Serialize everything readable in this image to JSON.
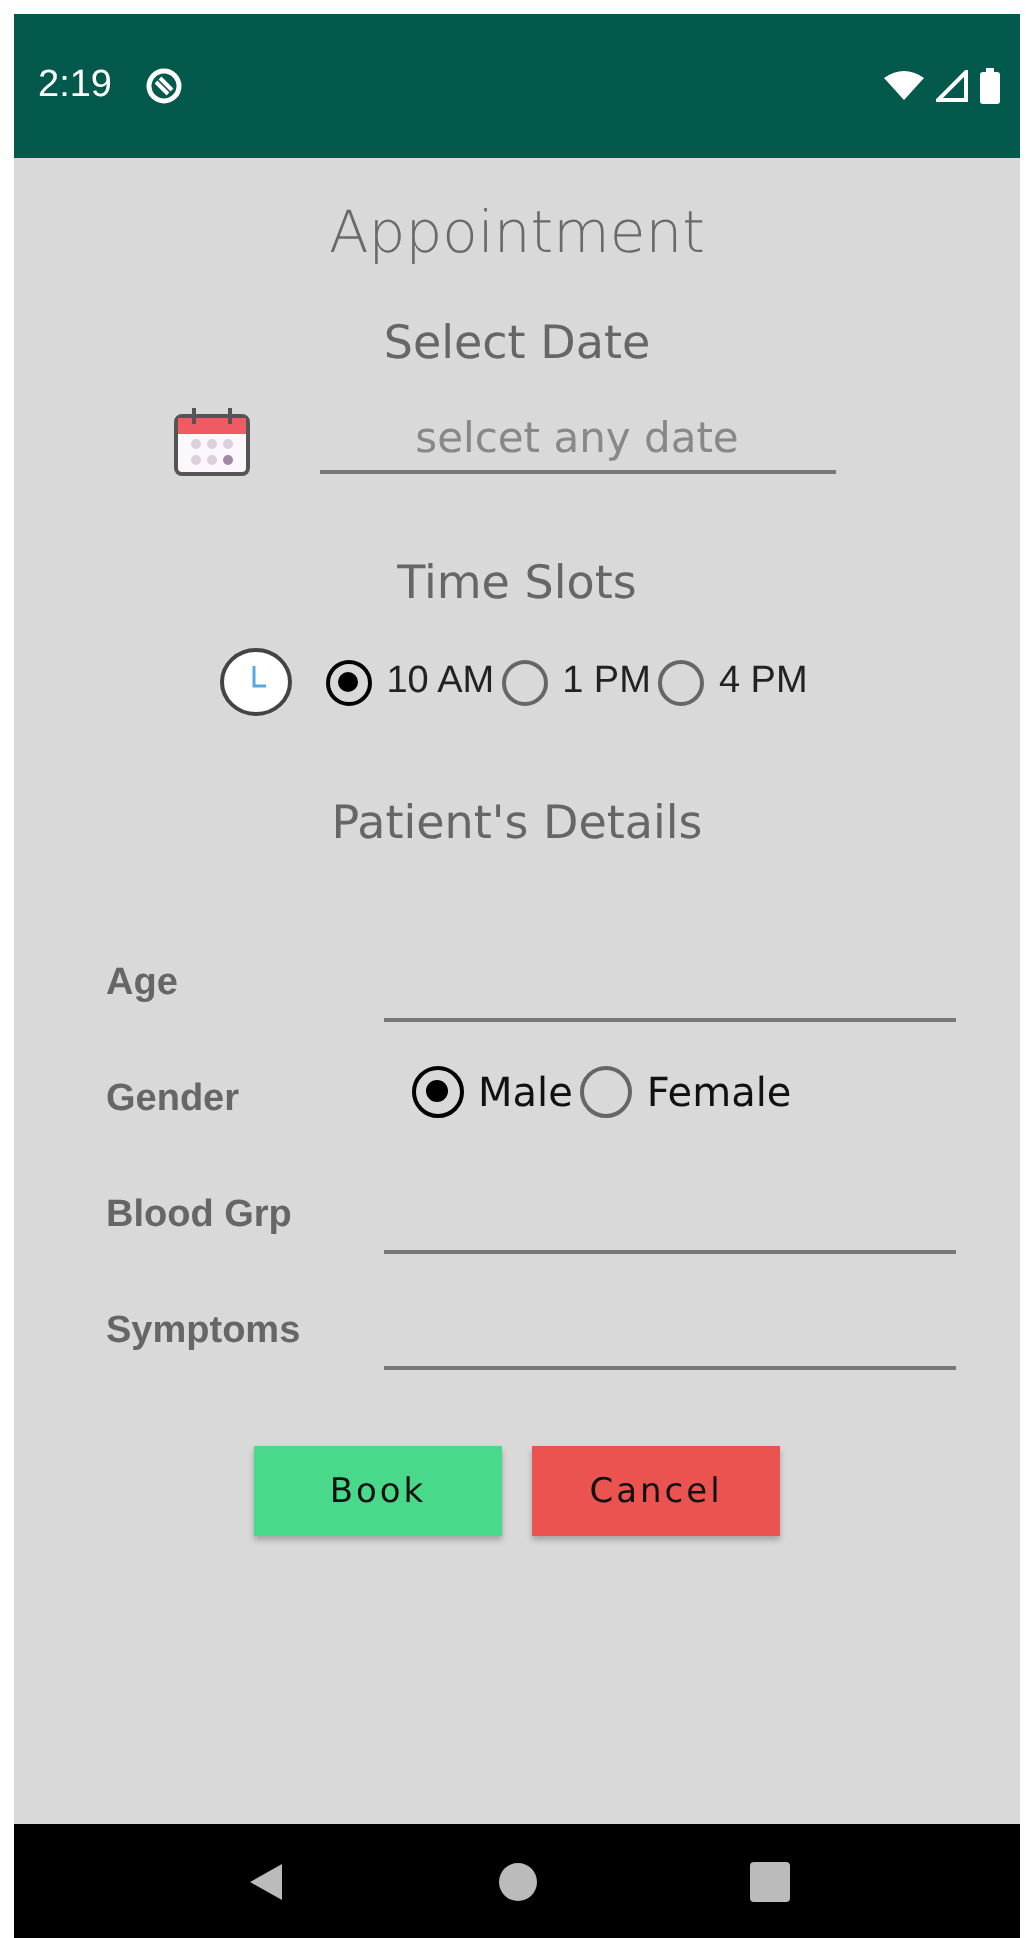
{
  "status_bar": {
    "time": "2:19"
  },
  "title": "Appointment",
  "date_section": {
    "heading": "Select Date",
    "placeholder": "selcet any date"
  },
  "time_section": {
    "heading": "Time Slots",
    "slots": [
      {
        "label": "10 AM",
        "selected": true
      },
      {
        "label": "1 PM",
        "selected": false
      },
      {
        "label": "4 PM",
        "selected": false
      }
    ]
  },
  "details_heading": "Patient's Details",
  "fields": [
    {
      "kind": "text",
      "label": "Age"
    },
    {
      "kind": "radio",
      "label": "Gender",
      "options": [
        {
          "label": "Male",
          "selected": true
        },
        {
          "label": "Female",
          "selected": false
        }
      ]
    },
    {
      "kind": "text",
      "label": "Blood Grp"
    },
    {
      "kind": "text",
      "label": "Symptoms"
    }
  ],
  "buttons": [
    {
      "kind": "primary",
      "label": "Book"
    },
    {
      "kind": "danger",
      "label": "Cancel"
    }
  ]
}
